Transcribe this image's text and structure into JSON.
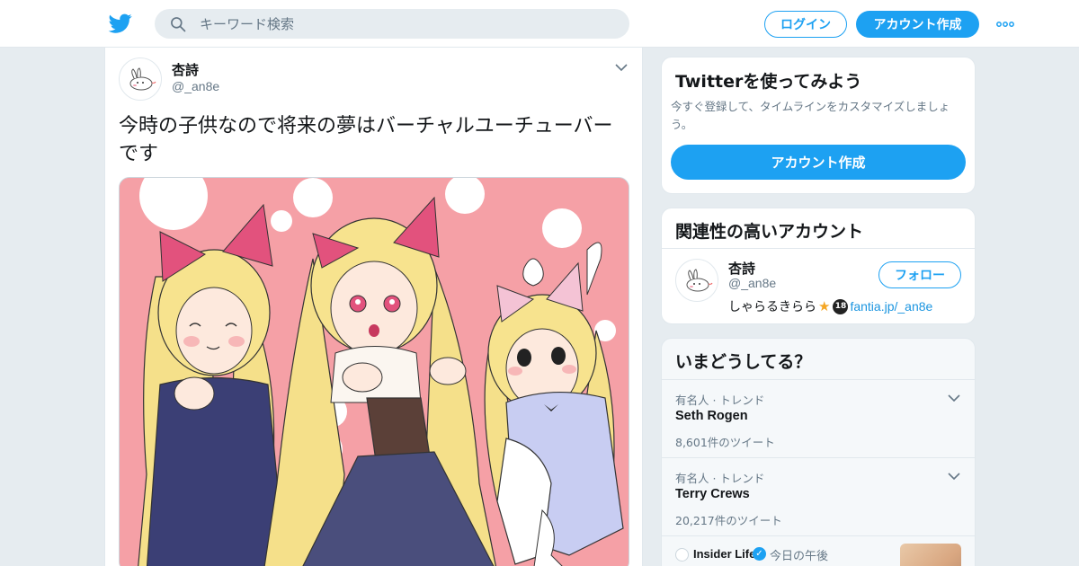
{
  "header": {
    "search_placeholder": "キーワード検索",
    "login_label": "ログイン",
    "signup_label": "アカウント作成",
    "accent_color": "#1da1f2"
  },
  "tweet": {
    "author_name": "杏詩",
    "author_handle": "@_an8e",
    "text": "今時の子供なので将来の夢はバーチャルユーチューバーです"
  },
  "sidebar": {
    "try_card": {
      "title": "Twitterを使ってみよう",
      "description": "今すぐ登録して、タイムラインをカスタマイズしましょう。",
      "button_label": "アカウント作成"
    },
    "related_card": {
      "title": "関連性の高いアカウント",
      "account": {
        "name": "杏詩",
        "handle": "@_an8e",
        "follow_label": "フォロー",
        "bio_text": "しゃらるきらら",
        "bio_badge": "18",
        "bio_link": "fantia.jp/_an8e"
      }
    },
    "trends_card": {
      "title": "いまどうしてる？",
      "trends": [
        {
          "context": "有名人 · トレンド",
          "name": "Seth Rogen",
          "count": "8,601件のツイート"
        },
        {
          "context": "有名人 · トレンド",
          "name": "Terry Crews",
          "count": "20,217件のツイート"
        }
      ],
      "news": {
        "source": "Insider Life",
        "time": "今日の午後"
      }
    }
  }
}
